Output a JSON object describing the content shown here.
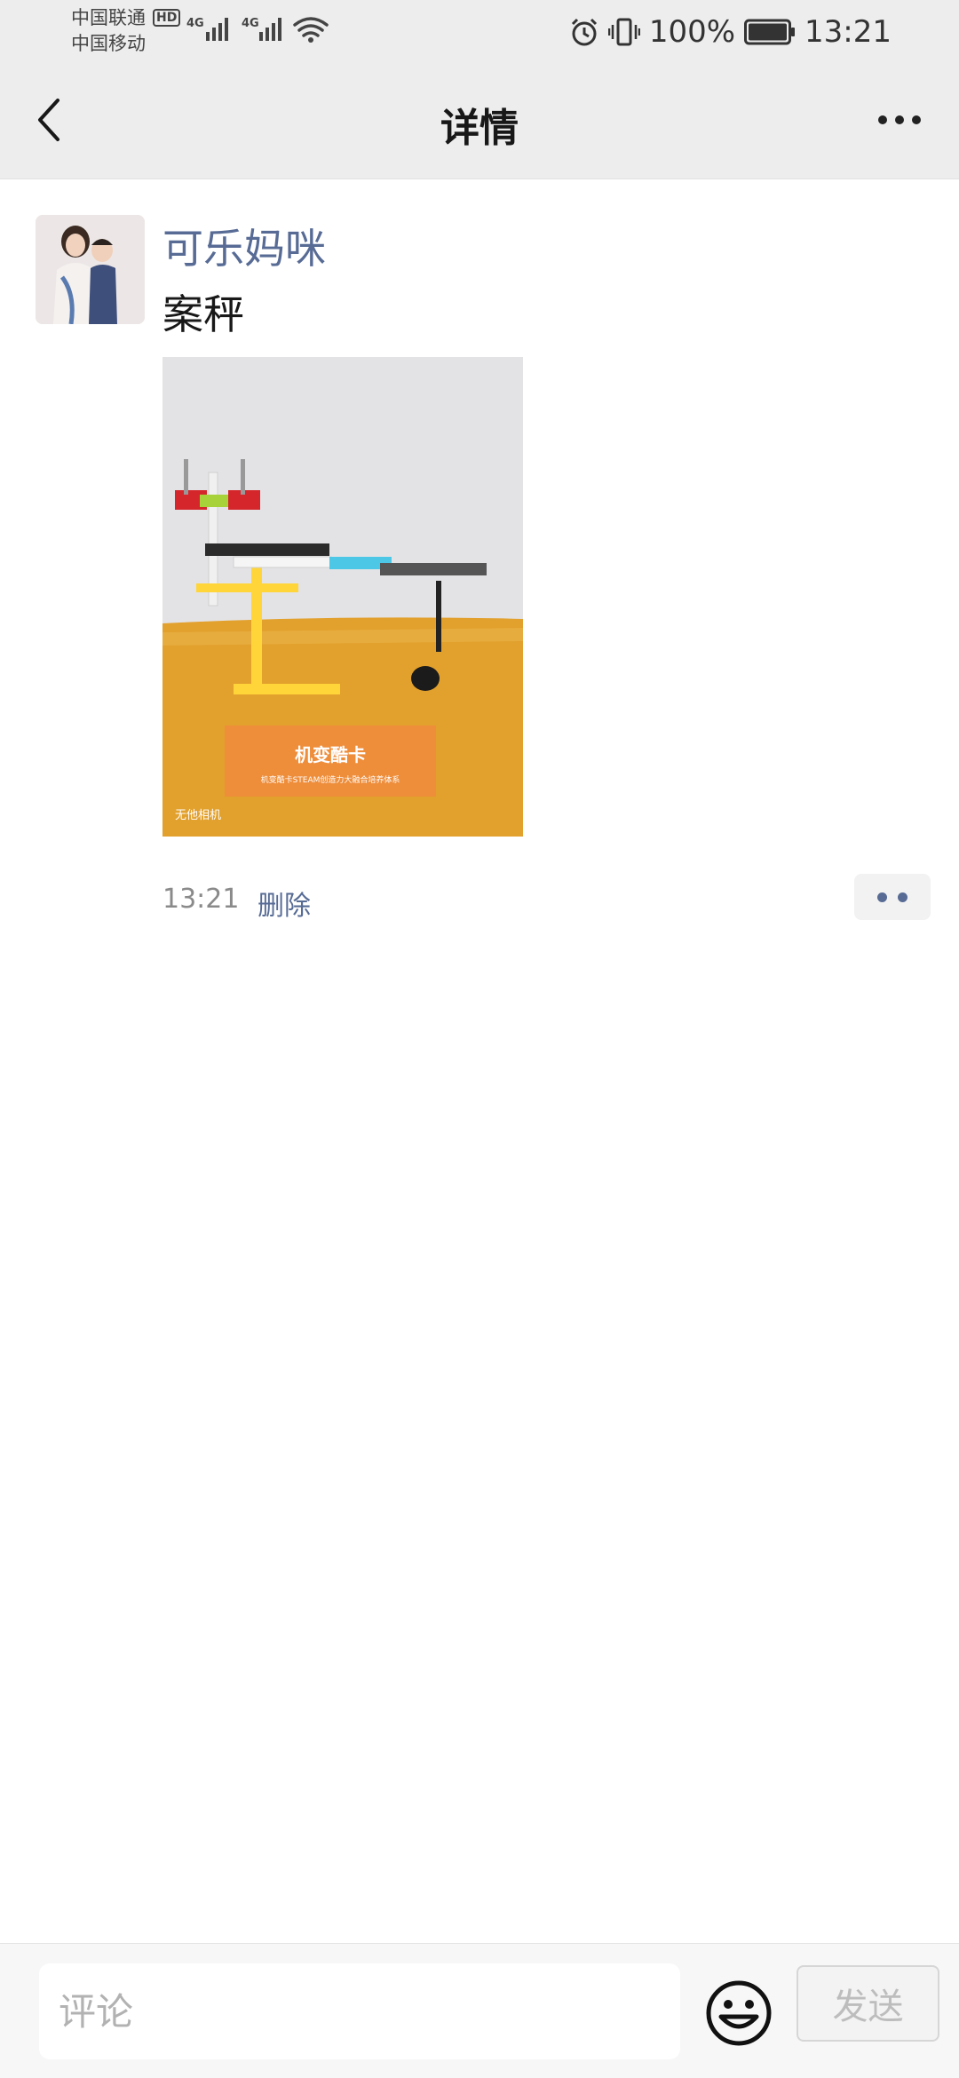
{
  "status_bar": {
    "carrier_1": "中国联通",
    "carrier_2": "中国移动",
    "hd_badge": "HD",
    "network_1": "4G",
    "network_2": "4G",
    "battery_pct": "100%",
    "time": "13:21"
  },
  "nav": {
    "title": "详情"
  },
  "post": {
    "author": "可乐妈咪",
    "text": "案秤",
    "time": "13:21",
    "delete_label": "删除",
    "photo": {
      "sign_title": "机变酷卡",
      "sign_subtitle": "机变酷卡STEAM创造力大融合培养体系",
      "watermark": "无他相机"
    }
  },
  "comment_bar": {
    "placeholder": "评论",
    "send_label": "发送"
  },
  "icons": {
    "back": "chevron-left-icon",
    "more": "more-icon",
    "emoji": "smiley-icon",
    "alarm": "alarm-icon",
    "vibrate": "vibrate-icon",
    "battery": "battery-icon",
    "wifi": "wifi-icon",
    "signal": "signal-icon"
  },
  "colors": {
    "link_blue": "#576b95",
    "nav_bg": "#ededed"
  }
}
